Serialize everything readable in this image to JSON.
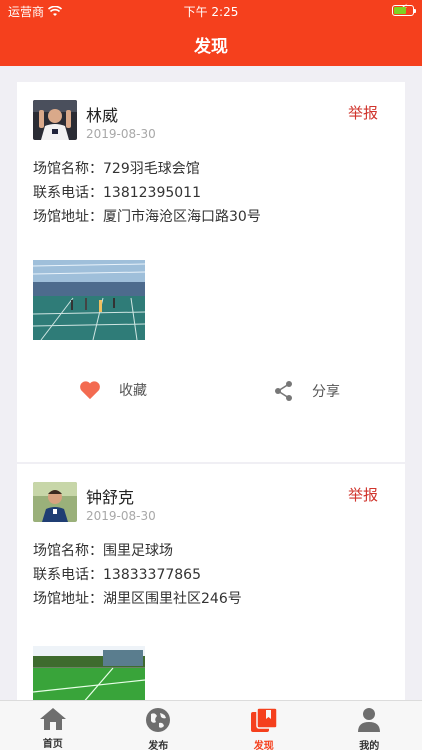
{
  "status_bar": {
    "carrier": "运营商",
    "time": "下午 2:25"
  },
  "nav": {
    "title": "发现"
  },
  "posts": [
    {
      "user_name": "林威",
      "date": "2019-08-30",
      "report_label": "举报",
      "venue_label": "场馆名称：",
      "venue_name": "729羽毛球会馆",
      "phone_label": "联系电话：",
      "phone": "13812395011",
      "address_label": "场馆地址：",
      "address": "厦门市海沧区海口路30号",
      "favorite_label": "收藏",
      "share_label": "分享"
    },
    {
      "user_name": "钟舒克",
      "date": "2019-08-30",
      "report_label": "举报",
      "venue_label": "场馆名称：",
      "venue_name": "围里足球场",
      "phone_label": "联系电话：",
      "phone": "13833377865",
      "address_label": "场馆地址：",
      "address": "湖里区围里社区246号"
    }
  ],
  "tabs": [
    {
      "label": "首页",
      "icon": "home-icon"
    },
    {
      "label": "发布",
      "icon": "globe-icon"
    },
    {
      "label": "发现",
      "icon": "discover-icon",
      "active": true
    },
    {
      "label": "我的",
      "icon": "person-icon"
    }
  ],
  "colors": {
    "brand": "#f5401d",
    "report": "#d0342c",
    "heart": "#f36b51"
  }
}
